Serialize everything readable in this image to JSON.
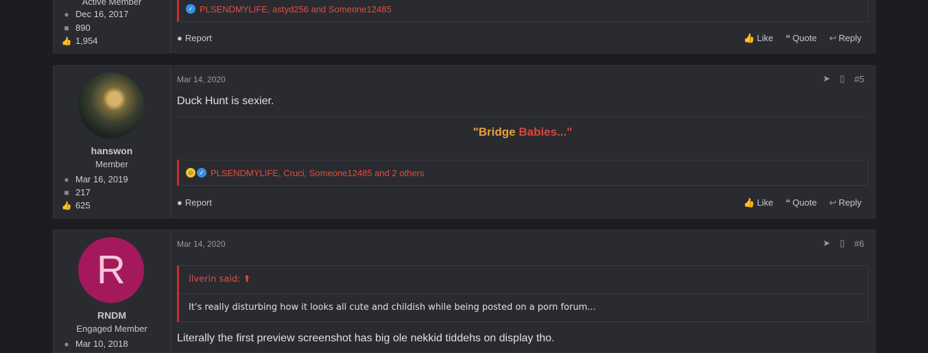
{
  "posts": [
    {
      "user": {
        "role": "Active Member",
        "joined": "Dec 16, 2017",
        "messages": "890",
        "reactions": "1,954"
      },
      "reactions_text": "PLSENDMYLIFE, astyd256 and Someone12485",
      "report": "Report",
      "like": "Like",
      "quote": "Quote",
      "reply": "Reply"
    },
    {
      "user": {
        "name": "hanswon",
        "role": "Member",
        "joined": "Mar 16, 2019",
        "messages": "217",
        "reactions": "625"
      },
      "date": "Mar 14, 2020",
      "number": "#5",
      "message": "Duck Hunt is sexier.",
      "signature": {
        "part1": "\"Bridge",
        "part2": "Babies...\""
      },
      "reactions_text": "PLSENDMYLIFE, Cruci, Someone12485 and 2 others",
      "report": "Report",
      "like": "Like",
      "quote": "Quote",
      "reply": "Reply"
    },
    {
      "user": {
        "avatar_letter": "R",
        "name": "RNDM",
        "role": "Engaged Member",
        "joined": "Mar 10, 2018"
      },
      "date": "Mar 14, 2020",
      "number": "#6",
      "quote_author": "Ilverin said:",
      "quote_text": "It's really disturbing how it looks all cute and childish while being posted on a porn forum...",
      "message": "Literally the first preview screenshot has big ole nekkid tiddehs on display tho."
    }
  ],
  "colors": {
    "accent": "#e24c3e",
    "background": "#1c1d21",
    "panel": "#2a2b30",
    "avatar_bg": "#a3195b"
  }
}
